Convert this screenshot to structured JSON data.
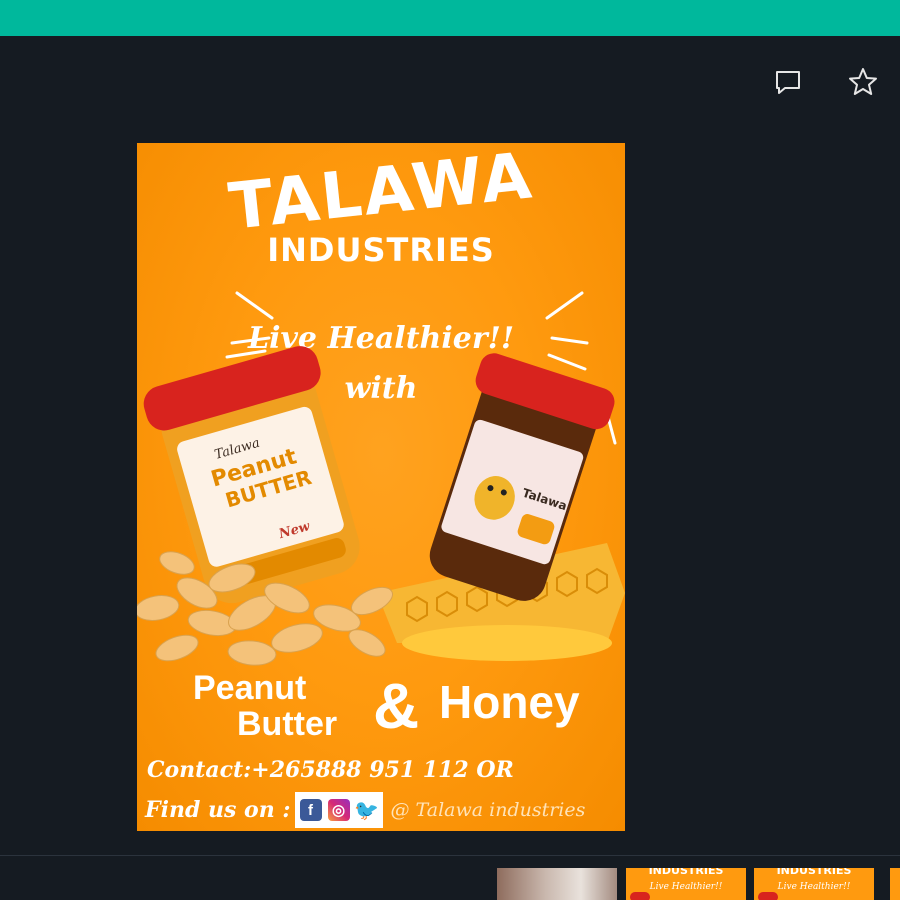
{
  "toolbar": {
    "comment_icon": "comment-icon",
    "star_icon": "star-icon"
  },
  "poster": {
    "title": "TALAWA",
    "subtitle": "INDUSTRIES",
    "tagline": "Live Healthier!!",
    "tagline_with": "with",
    "product_left_label": "Peanut Butter",
    "ampersand": "&",
    "product_right_label": "Honey",
    "contact": "Contact:+265888 951 112 OR",
    "find_us": "Find us on :",
    "handle": "@ Talawa industries",
    "jar1": {
      "brand": "Talawa",
      "name_line1": "Peanut",
      "name_line2": "BUTTER",
      "badge": "New"
    },
    "jar2": {
      "brand": "Talawa"
    },
    "colors": {
      "background": "#ff9a0f",
      "jar_lid": "#d8231e",
      "honey": "#f5a623"
    }
  },
  "pb_line1": "Peanut",
  "pb_line2": "Butter",
  "social": [
    "facebook-icon",
    "instagram-icon",
    "twitter-icon"
  ],
  "thumbnails": [
    {
      "title": "",
      "tag": ""
    },
    {
      "title": "INDUSTRIES",
      "tag": "Live Healthier!!"
    },
    {
      "title": "INDUSTRIES",
      "tag": "Live Healthier!!"
    },
    {
      "title": "",
      "tag": ""
    }
  ],
  "colors": {
    "top_bar": "#00b89c",
    "page_bg": "#151b22"
  }
}
